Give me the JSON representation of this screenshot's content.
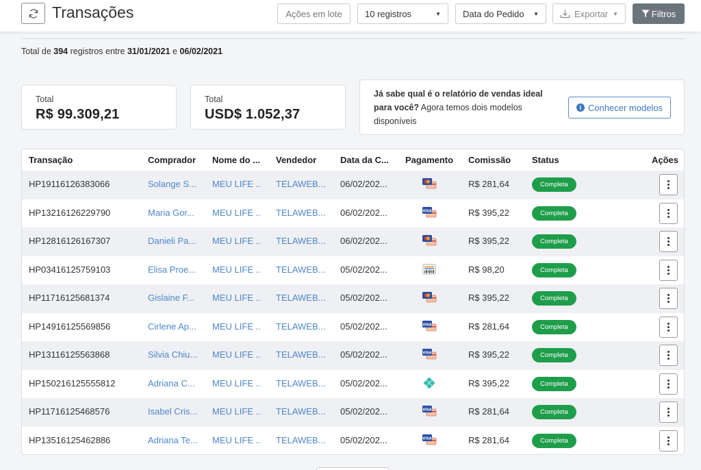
{
  "header": {
    "title": "Transações",
    "refresh_icon": "refresh-icon",
    "batch_label": "Ações em lote",
    "records_select": "10 registros",
    "date_select": "Data do Pedido",
    "export_label": "Exportar",
    "filters_label": "Filtros"
  },
  "summary": {
    "prefix": "Total de ",
    "count": "394",
    "mid": " registros entre ",
    "date_from": "31/01/2021",
    "conj": " e ",
    "date_to": "06/02/2021"
  },
  "totals": {
    "brl_label": "Total",
    "brl_value": "R$ 99.309,21",
    "usd_label": "Total",
    "usd_value": "USD$ 1.052,37"
  },
  "info_card": {
    "bold_text": "Já sabe qual é o relatório de vendas ideal para você?",
    "text": " Agora temos dois modelos disponíveis",
    "button_label": "Conhecer modelos"
  },
  "table": {
    "columns": [
      "Transação",
      "Comprador",
      "Nome do ...",
      "Vendedor",
      "Data da C...",
      "Pagamento",
      "Comissão",
      "Status",
      "Ações"
    ],
    "rows": [
      {
        "tx": "HP19116126383066",
        "buyer": "Solange S...",
        "product": "MEU LIFE ...",
        "seller": "TELAWEB...",
        "date": "06/02/202...",
        "payment": "mastercard-card-icon",
        "commission": "R$ 281,64",
        "status": "Completa"
      },
      {
        "tx": "HP13216126229790",
        "buyer": "Maria Gor...",
        "product": "MEU LIFE ...",
        "seller": "TELAWEB...",
        "date": "06/02/202...",
        "payment": "visa-card-icon",
        "commission": "R$ 395,22",
        "status": "Completa"
      },
      {
        "tx": "HP12816126167307",
        "buyer": "Danieli Pa...",
        "product": "MEU LIFE ...",
        "seller": "TELAWEB...",
        "date": "06/02/202...",
        "payment": "mastercard-card-icon",
        "commission": "R$ 395,22",
        "status": "Completa"
      },
      {
        "tx": "HP03416125759103",
        "buyer": "Elisa Proe...",
        "product": "MEU LIFE ...",
        "seller": "TELAWEB...",
        "date": "05/02/202...",
        "payment": "boleto-icon",
        "commission": "R$ 98,20",
        "status": "Completa"
      },
      {
        "tx": "HP11716125681374",
        "buyer": "Gislaine F...",
        "product": "MEU LIFE ...",
        "seller": "TELAWEB...",
        "date": "05/02/202...",
        "payment": "mastercard-card-icon",
        "commission": "R$ 395,22",
        "status": "Completa"
      },
      {
        "tx": "HP14916125569856",
        "buyer": "Cirlene Ap...",
        "product": "MEU LIFE ...",
        "seller": "TELAWEB...",
        "date": "05/02/202...",
        "payment": "visa-card-icon",
        "commission": "R$ 281,64",
        "status": "Completa"
      },
      {
        "tx": "HP13116125563868",
        "buyer": "Silvia Chiu...",
        "product": "MEU LIFE ...",
        "seller": "TELAWEB...",
        "date": "05/02/202...",
        "payment": "visa-card-icon",
        "commission": "R$ 395,22",
        "status": "Completa"
      },
      {
        "tx": "HP150216125555812",
        "buyer": "Adriana C...",
        "product": "MEU LIFE ...",
        "seller": "TELAWEB...",
        "date": "05/02/202...",
        "payment": "pix-icon",
        "commission": "R$ 395,22",
        "status": "Completa"
      },
      {
        "tx": "HP11716125468576",
        "buyer": "Isabel Cris...",
        "product": "MEU LIFE ...",
        "seller": "TELAWEB...",
        "date": "05/02/202...",
        "payment": "visa-card-icon",
        "commission": "R$ 281,64",
        "status": "Completa"
      },
      {
        "tx": "HP13516125462886",
        "buyer": "Adriana Te...",
        "product": "MEU LIFE ...",
        "seller": "TELAWEB...",
        "date": "05/02/202...",
        "payment": "visa-card-icon",
        "commission": "R$ 281,64",
        "status": "Completa"
      }
    ]
  },
  "colors": {
    "status_green": "#1e9e4a",
    "link_blue": "#4f86c9",
    "filters_bg": "#6c757d",
    "row_stripe": "#eef0f3"
  }
}
